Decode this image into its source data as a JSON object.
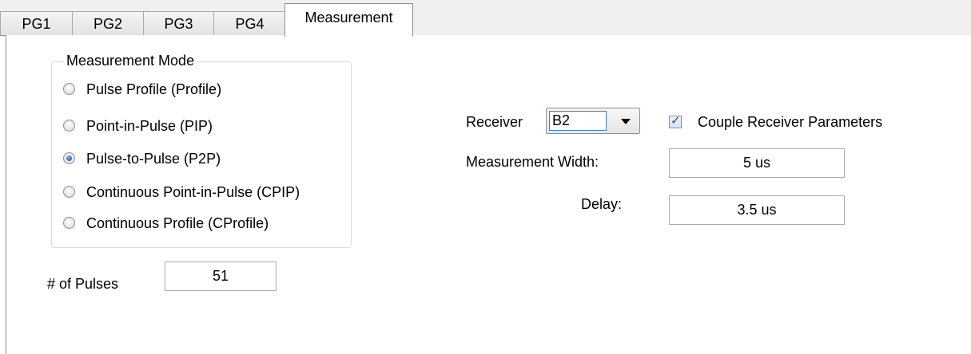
{
  "tabs": [
    "PG1",
    "PG2",
    "PG3",
    "PG4",
    "Measurement"
  ],
  "active_tab": "Measurement",
  "measurement_mode": {
    "legend": "Measurement Mode",
    "options": [
      {
        "label": "Pulse Profile (Profile)",
        "checked": false
      },
      {
        "label": "Point-in-Pulse (PIP)",
        "checked": false
      },
      {
        "label": "Pulse-to-Pulse (P2P)",
        "checked": true
      },
      {
        "label": "Continuous Point-in-Pulse (CPIP)",
        "checked": false
      },
      {
        "label": "Continuous Profile (CProfile)",
        "checked": false
      }
    ]
  },
  "pulses": {
    "label": "# of Pulses",
    "value": "51"
  },
  "receiver": {
    "label": "Receiver",
    "value": "B2"
  },
  "couple": {
    "label": "Couple Receiver Parameters",
    "checked": true
  },
  "measurement_width": {
    "label": "Measurement Width:",
    "value": "5 us"
  },
  "delay": {
    "label": "Delay:",
    "value": "3.5 us"
  }
}
